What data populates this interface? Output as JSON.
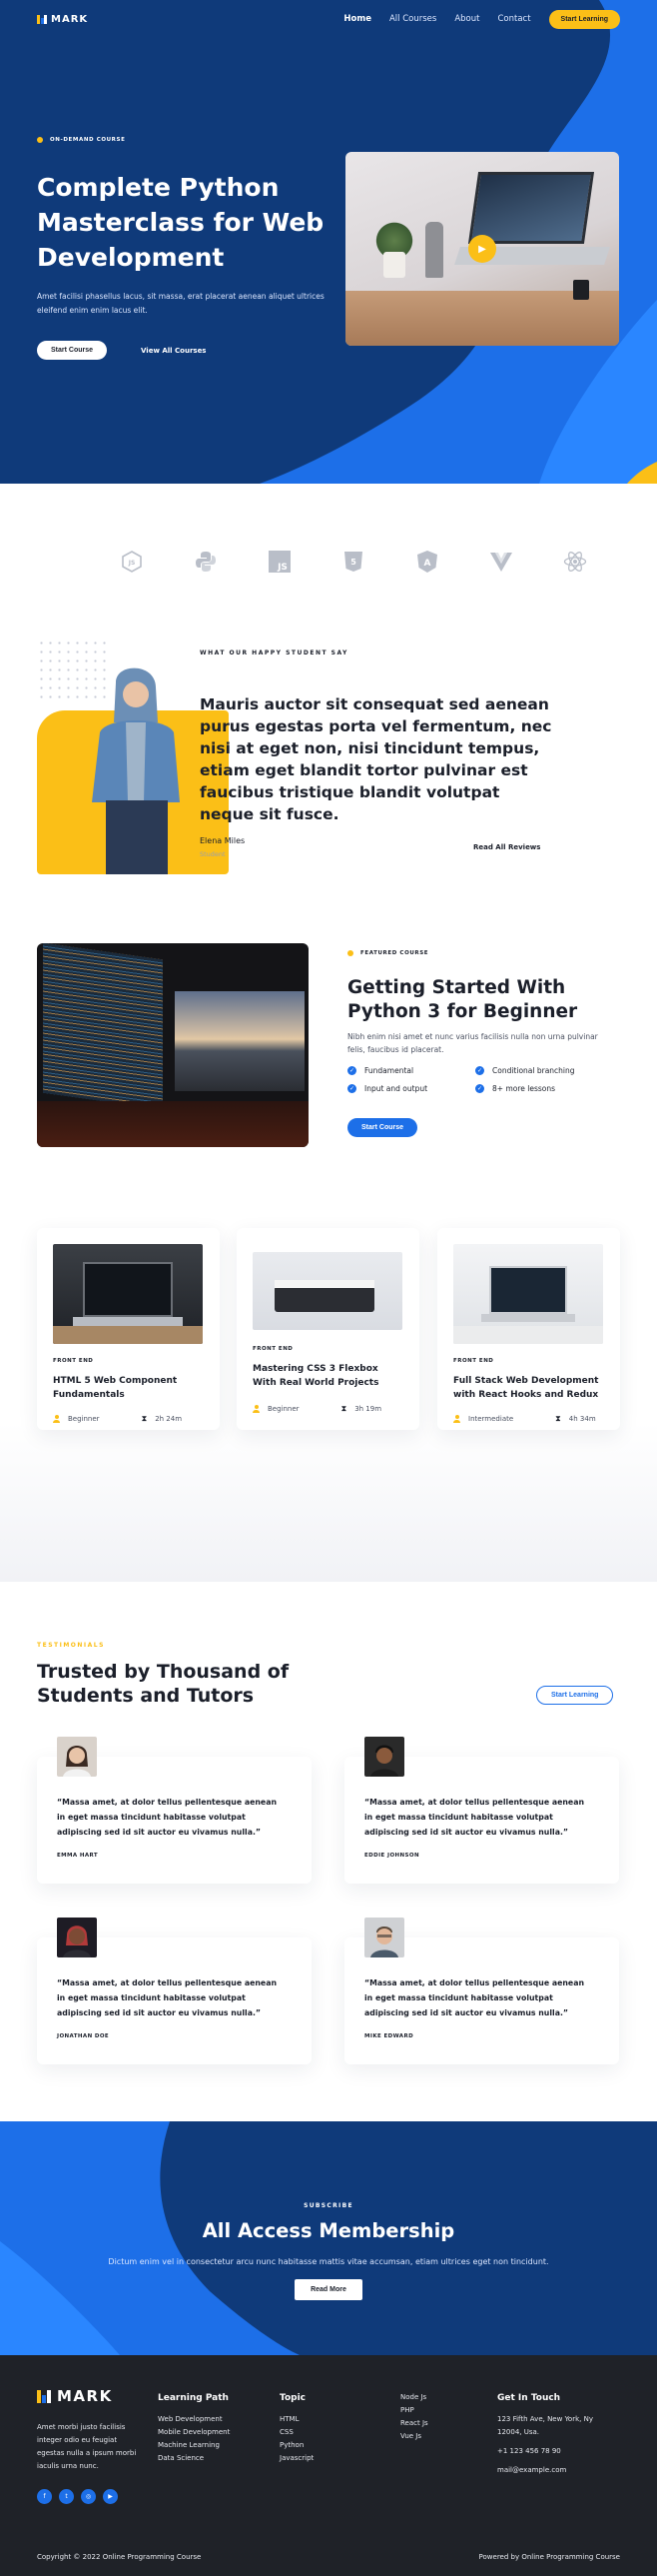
{
  "nav": {
    "logo": "MARK",
    "links": [
      "Home",
      "All Courses",
      "About",
      "Contact"
    ],
    "cta": "Start Learning"
  },
  "hero": {
    "tag": "ON-DEMAND COURSE",
    "title": "Complete Python Masterclass for Web Development",
    "text": "Amet facilisi phasellus lacus, sit massa, erat placerat aenean aliquet ultrices eleifend enim enim lacus elit.",
    "primary_button": "Start Course",
    "secondary_link": "View All Courses"
  },
  "tech_logos": [
    "nodejs-icon",
    "python-icon",
    "js-icon",
    "html5-icon",
    "angular-icon",
    "vue-icon",
    "react-icon"
  ],
  "testimonial": {
    "label": "WHAT OUR HAPPY STUDENT SAY",
    "quote": "Mauris auctor sit consequat sed aenean purus egestas porta vel fermentum, nec nisi at eget non, nisi tincidunt tempus, etiam eget blandit tortor pulvinar est faucibus tristique blandit volutpat neque sit fusce.",
    "name": "Elena Miles",
    "role": "Student",
    "link": "Read All Reviews"
  },
  "featured": {
    "tag": "FEATURED COURSE",
    "title": "Getting Started With Python 3 for Beginner",
    "text": "Nibh enim nisi amet et nunc varius facilisis nulla non urna pulvinar felis, faucibus id placerat.",
    "features": [
      "Fundamental",
      "Conditional branching",
      "Input and output",
      "8+ more lessons"
    ],
    "button": "Start Course"
  },
  "courses": [
    {
      "category": "FRONT END",
      "title": "HTML 5 Web Component Fundamentals",
      "level": "Beginner",
      "duration": "2h 24m"
    },
    {
      "category": "FRONT END",
      "title": "Mastering CSS 3 Flexbox With Real World Projects",
      "level": "Beginner",
      "duration": "3h 19m"
    },
    {
      "category": "FRONT END",
      "title": "Full Stack Web Development with React Hooks and Redux",
      "level": "Intermediate",
      "duration": "4h 34m"
    }
  ],
  "trusted": {
    "tag": "TESTIMONIALS",
    "title": "Trusted by Thousand of Students and Tutors",
    "button": "Start Learning",
    "reviews": [
      {
        "text": "“Massa amet, at dolor tellus pellentesque aenean in eget massa tincidunt habitasse volutpat adipiscing sed id sit auctor eu vivamus nulla.”",
        "name": "EMMA HART"
      },
      {
        "text": "“Massa amet, at dolor tellus pellentesque aenean in eget massa tincidunt habitasse volutpat adipiscing sed id sit auctor eu vivamus nulla.”",
        "name": "EDDIE JOHNSON"
      },
      {
        "text": "“Massa amet, at dolor tellus pellentesque aenean in eget massa tincidunt habitasse volutpat adipiscing sed id sit auctor eu vivamus nulla.”",
        "name": "JONATHAN DOE"
      },
      {
        "text": "“Massa amet, at dolor tellus pellentesque aenean in eget massa tincidunt habitasse volutpat adipiscing sed id sit auctor eu vivamus nulla.”",
        "name": "MIKE EDWARD"
      }
    ]
  },
  "subscribe": {
    "tag": "SUBSCRIBE",
    "title": "All Access Membership",
    "text": "Dictum enim vel in consectetur arcu nunc habitasse mattis vitae accumsan, etiam ultrices eget non tincidunt.",
    "button": "Read More"
  },
  "footer": {
    "logo": "MARK",
    "about": "Amet morbi justo facilisis integer odio eu feugiat egestas nulla a ipsum morbi iaculis urna nunc.",
    "learning_path": {
      "title": "Learning Path",
      "items": [
        "Web Development",
        "Mobile Development",
        "Machine Learning",
        "Data Science"
      ]
    },
    "topic": {
      "title": "Topic",
      "items": [
        "HTML",
        "CSS",
        "Python",
        "Javascript"
      ]
    },
    "topic2": {
      "items": [
        "Node Js",
        "PHP",
        "React Js",
        "Vue Js"
      ]
    },
    "contact": {
      "title": "Get In Touch",
      "address": "123 Fifth Ave, New York, Ny 12004, Usa.",
      "phone": "+1 123 456 78 90",
      "email": "mail@example.com"
    },
    "copyright": "Copyright © 2022 Online Programming Course",
    "powered": "Powered by Online Programming Course"
  },
  "colors": {
    "navy": "#0f3a7a",
    "blue": "#1d6fe8",
    "yellow": "#fbbf17",
    "dark": "#1f2228"
  }
}
